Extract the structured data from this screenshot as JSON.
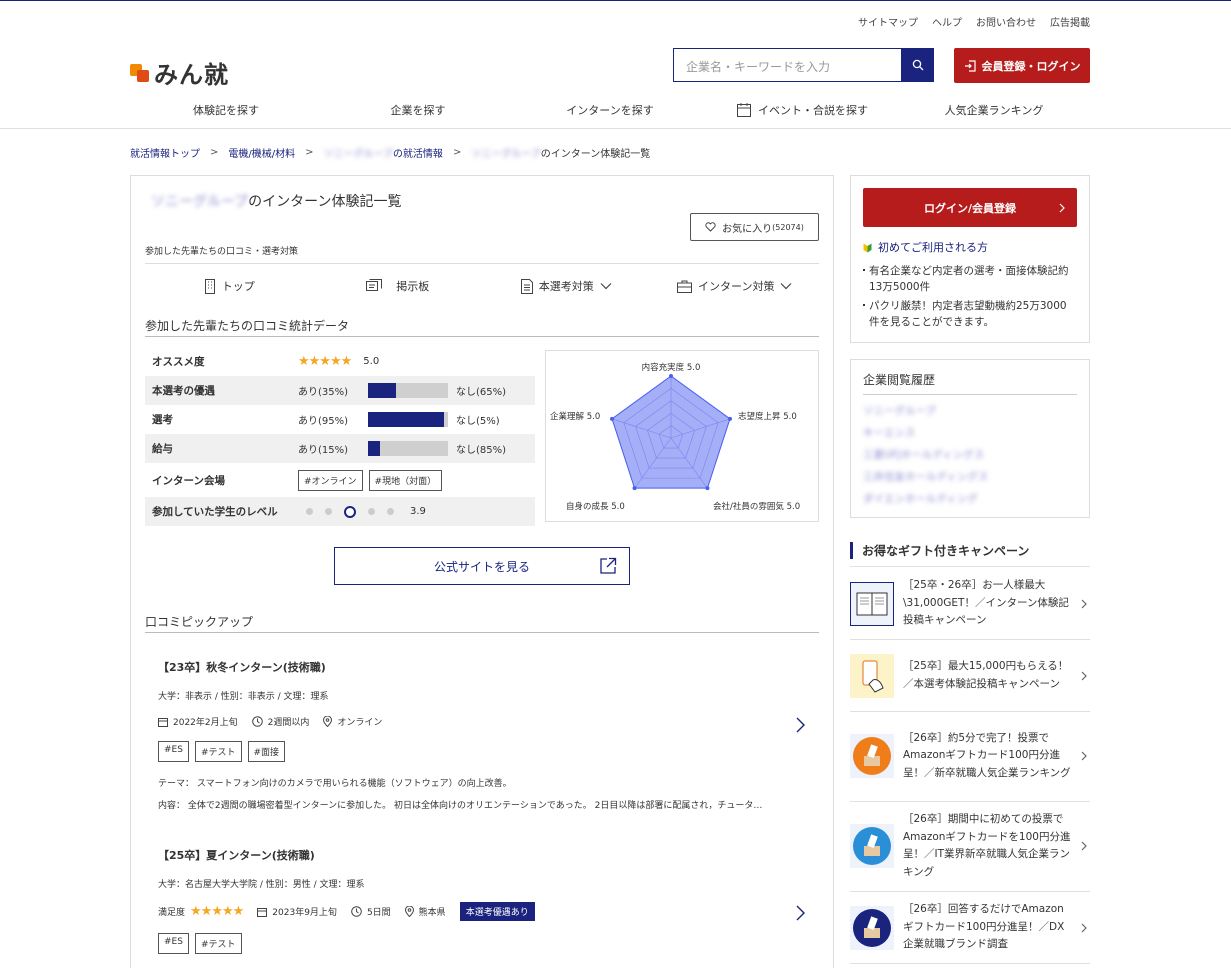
{
  "top_links": [
    "サイトマップ",
    "ヘルプ",
    "お問い合わせ",
    "広告掲載"
  ],
  "logo_text": "みん就",
  "search": {
    "placeholder": "企業名・キーワードを入力"
  },
  "login_button": "会員登録・ログイン",
  "nav": [
    "体験記を探す",
    "企業を探す",
    "インターンを探す",
    "イベント・合説を探す",
    "人気企業ランキング"
  ],
  "breadcrumb": {
    "home": "就活情報トップ",
    "category": "電機/機械/材料",
    "company_blurred": "ソニーグループ",
    "company_suffix": "の就活情報",
    "current_blurred": "ソニーグループ",
    "current_suffix": "のインターン体験記一覧",
    "sep": ">"
  },
  "page": {
    "company_blurred": "ソニーグループ",
    "title_suffix": "のインターン体験記一覧",
    "fav_label": "お気に入り",
    "fav_count": "(52074)",
    "subtitle": "参加した先輩たちの口コミ・選考対策",
    "tabs": [
      "トップ",
      "掲示板",
      "本選考対策",
      "インターン対策"
    ]
  },
  "stats": {
    "title": "参加した先輩たちの口コミ統計データ",
    "recommend_label": "オススメ度",
    "recommend_score": "5.0",
    "rows": [
      {
        "label": "本選考の優遇",
        "yes": "あり(35%)",
        "no": "なし(65%)",
        "pct": 35
      },
      {
        "label": "選考",
        "yes": "あり(95%)",
        "no": "なし(5%)",
        "pct": 95
      },
      {
        "label": "給与",
        "yes": "あり(15%)",
        "no": "なし(85%)",
        "pct": 15
      }
    ],
    "venue_label": "インターン会場",
    "venue_tags": [
      "#オンライン",
      "#現地（対面）"
    ],
    "level_label": "参加していた学生のレベル",
    "level_value": "3.9"
  },
  "radar": {
    "labels": [
      "内容充実度",
      "志望度上昇",
      "会社/社員の雰囲気",
      "自身の成長",
      "企業理解"
    ],
    "values": [
      "5.0",
      "5.0",
      "5.0",
      "5.0",
      "5.0"
    ],
    "scores": [
      5,
      5,
      5,
      5,
      5
    ],
    "max": 5
  },
  "official_button": "公式サイトを見る",
  "pickup": {
    "title": "口コミピックアップ",
    "reviews": [
      {
        "title": "【23卒】秋冬インターン(技術職)",
        "meta": "大学：非表示 / 性別：非表示 / 文理：理系",
        "date": "2022年2月上旬",
        "duration": "2週間以内",
        "place": "オンライン",
        "tags": [
          "#ES",
          "#テスト",
          "#面接"
        ],
        "theme": "テーマ：  スマートフォン向けのカメラで用いられる機能（ソフトウェア）の向上改善。",
        "content": "内容：  全体で2週間の職場密着型インターンに参加した。 初日は全体向けのオリエンテーションであった。 2日目以降は部署に配属され，チュータ…"
      },
      {
        "title": "【25卒】夏インターン(技術職)",
        "meta": "大学：名古屋大学大学院 / 性別：男性 / 文理：理系",
        "satisfaction_label": "満足度",
        "date": "2023年9月上旬",
        "duration": "5日間",
        "place": "熊本県",
        "badge": "本選考優遇あり",
        "tags": [
          "#ES",
          "#テスト"
        ]
      }
    ]
  },
  "side": {
    "login_button": "ログイン/会員登録",
    "first_link": "初めてご利用される方",
    "bullets": [
      "有名企業など内定者の選考・面接体験記約13万5000件",
      "パクリ厳禁！内定者志望動機約25万3000件を見ることができます。"
    ],
    "history_title": "企業閲覧履歴",
    "history": [
      "ソニーグループ",
      "キーエンス",
      "三菱UFJホールディングス",
      "三井住友ホールディングス",
      "ダイエンホールディング"
    ],
    "campaign_title": "お得なギフト付きキャンペーン",
    "campaigns": [
      "［25卒・26卒］お一人様最大\\31,000GET！／インターン体験記投稿キャンペーン",
      "［25卒］最大15,000円もらえる！／本選考体験記投稿キャンペーン",
      "［26卒］約5分で完了！投票でAmazonギフトカード100円分進呈！／新卒就職人気企業ランキング",
      "［26卒］期間中に初めての投票でAmazonギフトカードを100円分進呈！／IT業界新卒就職人気企業ランキング",
      "［26卒］回答するだけでAmazonギフトカード100円分進呈！／DX企業就職ブランド調査"
    ]
  },
  "colors": {
    "navy": "#1a237e",
    "red": "#b71c1c",
    "star": "#f5a623"
  }
}
